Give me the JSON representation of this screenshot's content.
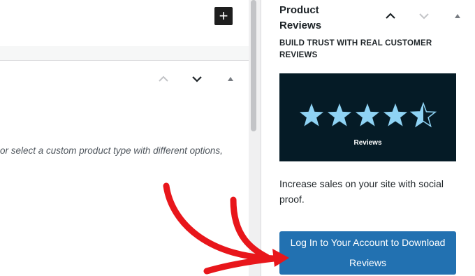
{
  "editor": {
    "add_block_symbol": "+",
    "panel_hint": "or select a custom product type with different options,"
  },
  "sidebar": {
    "title": "Product Reviews",
    "tagline": "BUILD TRUST WITH REAL CUSTOMER REVIEWS",
    "promo": {
      "label": "Reviews",
      "rating": 4.5,
      "rating_max": 5,
      "background_color": "#051b26",
      "star_color": "#8fd3f4"
    },
    "description": "Increase sales on your site with social proof.",
    "cta_label": "Log In to Your Account to Download Reviews",
    "cta_color": "#2271b1"
  },
  "annotation": {
    "arrow_color": "#e8161b"
  }
}
